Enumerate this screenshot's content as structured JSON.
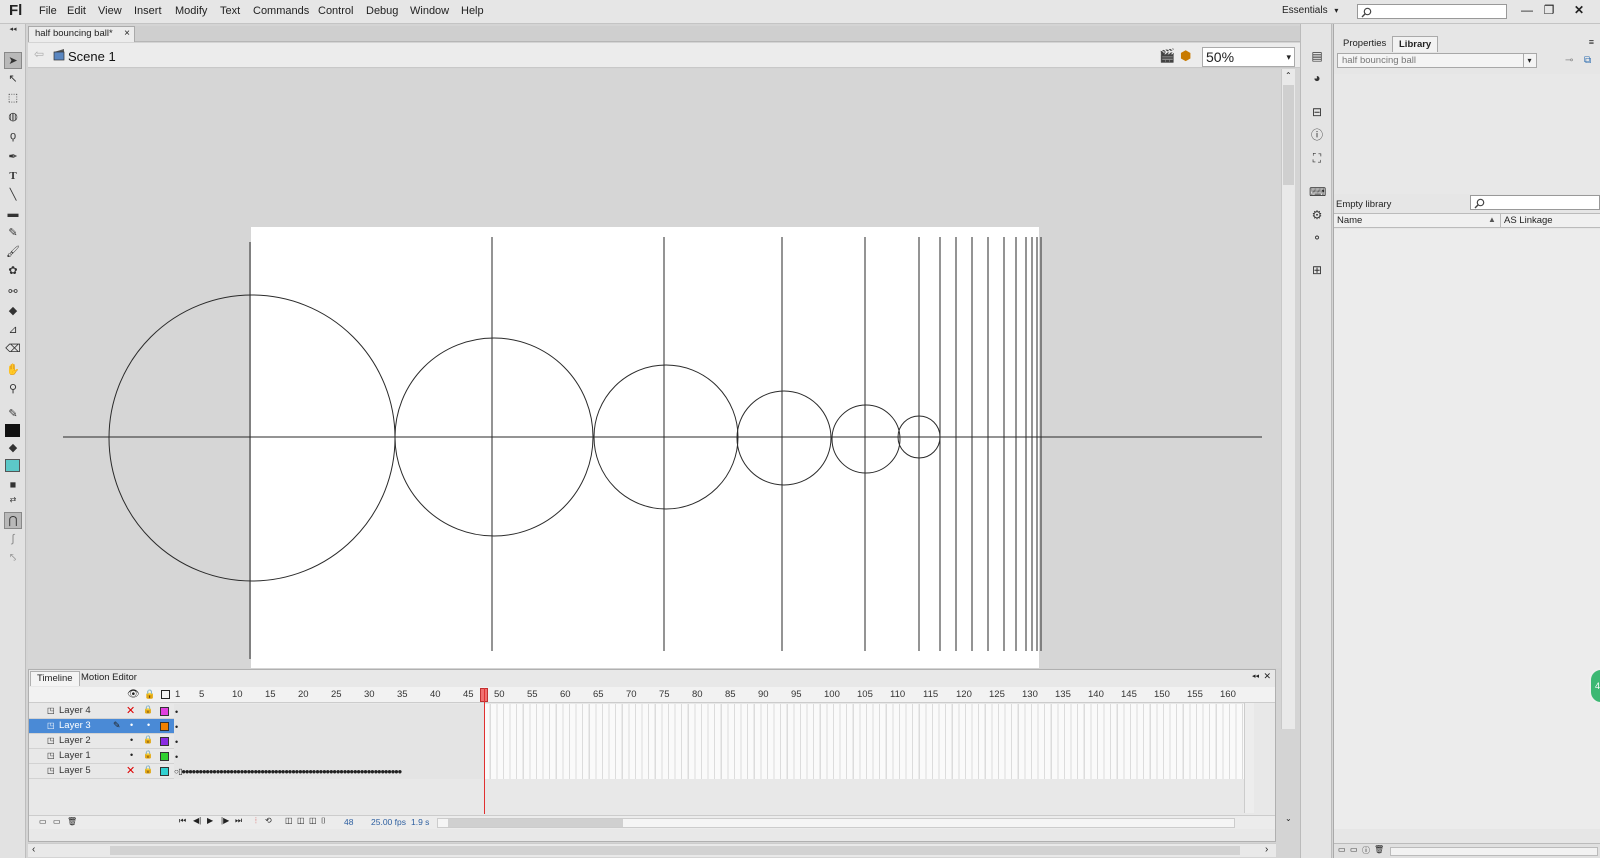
{
  "app": {
    "logo": "Fl",
    "menu": [
      "File",
      "Edit",
      "View",
      "Insert",
      "Modify",
      "Text",
      "Commands",
      "Control",
      "Debug",
      "Window",
      "Help"
    ],
    "workspace": "Essentials",
    "search_placeholder": "",
    "window_buttons": [
      "—",
      "❐",
      "✕"
    ]
  },
  "document": {
    "tab_title": "half bouncing ball*",
    "tab_close": "×",
    "scene": "Scene 1",
    "zoom": "50%"
  },
  "timeline": {
    "tabs": [
      "Timeline",
      "Motion Editor"
    ],
    "frame_ruler": [
      "1",
      "5",
      "10",
      "15",
      "20",
      "25",
      "30",
      "35",
      "40",
      "45",
      "50",
      "55",
      "60",
      "65",
      "70",
      "75",
      "80",
      "85",
      "90",
      "95",
      "100",
      "105",
      "110",
      "115",
      "120",
      "125",
      "130",
      "135",
      "140",
      "145",
      "150",
      "155",
      "160"
    ],
    "layers": [
      {
        "name": "Layer 4",
        "visibility": "hidden",
        "color": "#e040e0"
      },
      {
        "name": "Layer 3",
        "visibility": "visible",
        "color": "#f08000",
        "selected": true
      },
      {
        "name": "Layer 2",
        "visibility": "visible",
        "color": "#8a2be2"
      },
      {
        "name": "Layer 1",
        "visibility": "visible",
        "color": "#30d030"
      },
      {
        "name": "Layer 5",
        "visibility": "hidden",
        "color": "#30d0d0"
      }
    ],
    "current_frame": "48",
    "fps": "25.00 fps",
    "elapsed": "1.9 s"
  },
  "library": {
    "tabs": [
      "Properties",
      "Library"
    ],
    "selected_document": "half bouncing ball",
    "empty_text": "Empty library",
    "columns": [
      "Name",
      "AS Linkage"
    ]
  },
  "badge": "4"
}
